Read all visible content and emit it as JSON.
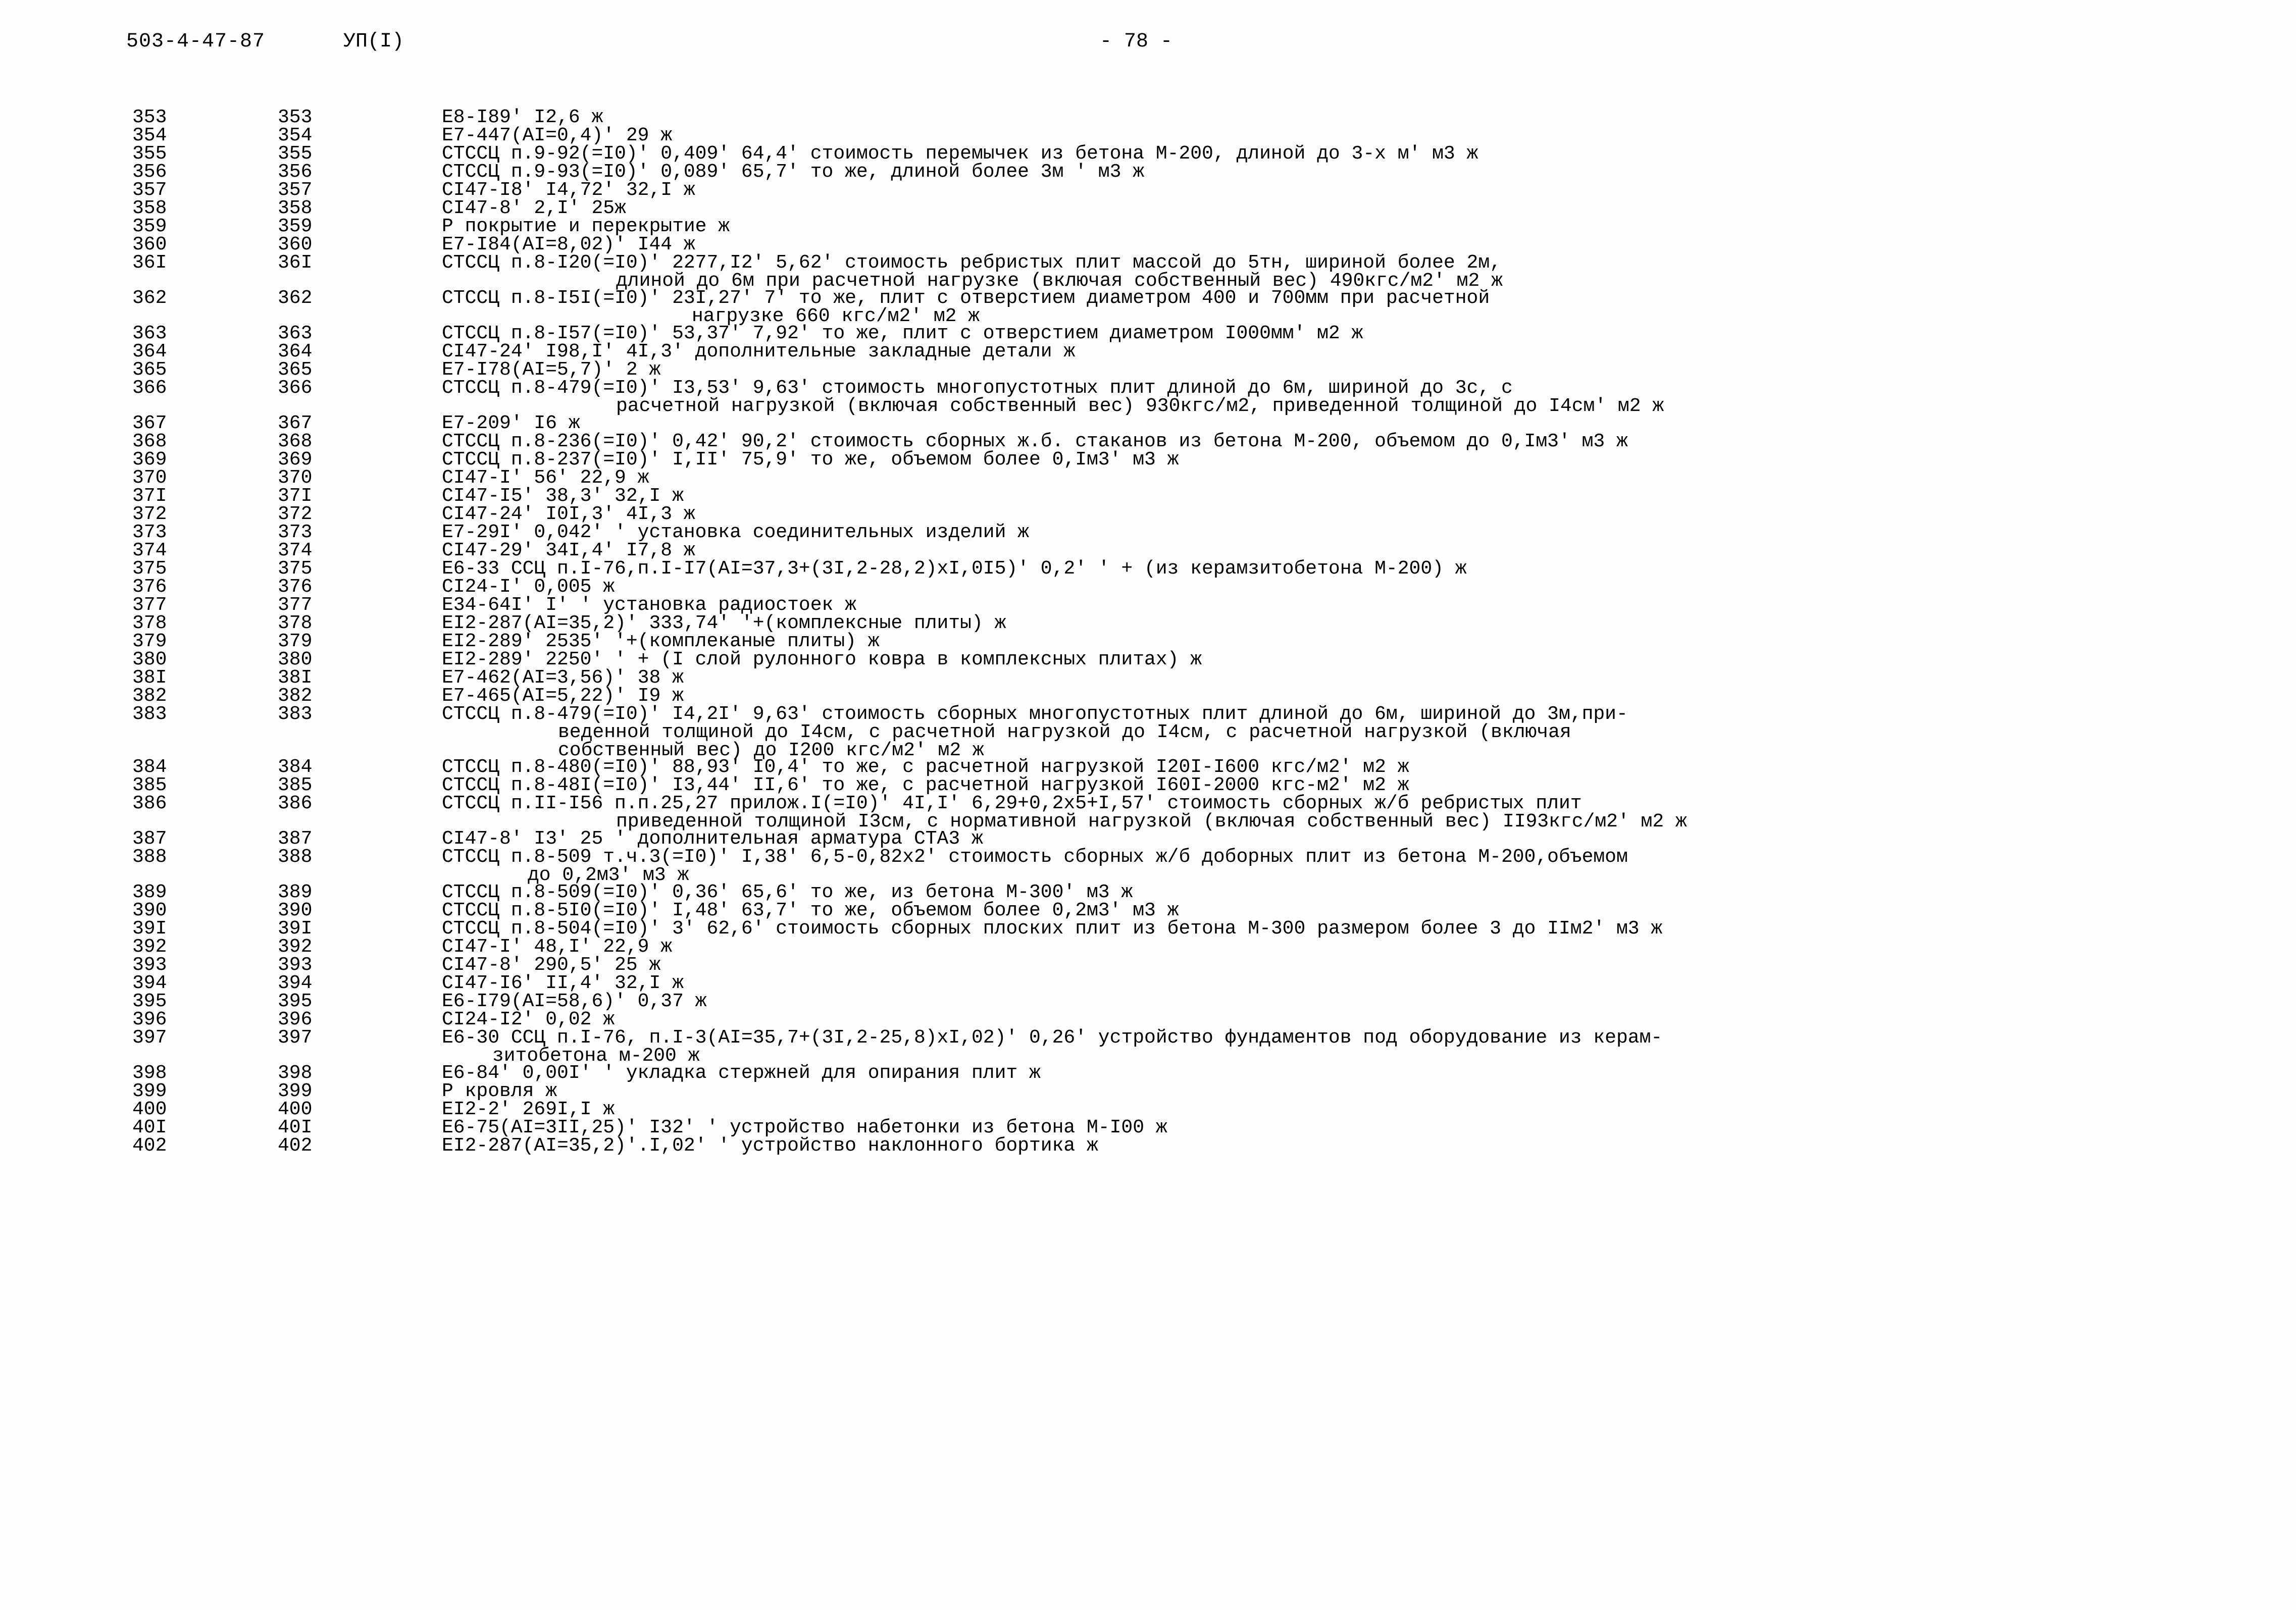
{
  "header": {
    "code": "503-4-47-87",
    "mark": "УП(I)",
    "page": "- 78 -"
  },
  "columns": {
    "col1_header": "",
    "col2_header": "",
    "col3_header": ""
  },
  "rows": [
    {
      "n1": "353",
      "n2": "353",
      "lines": [
        "Е8-I89' I2,6 ж"
      ]
    },
    {
      "n1": "354",
      "n2": "354",
      "lines": [
        "Е7-447(АI=0,4)' 29 ж"
      ]
    },
    {
      "n1": "355",
      "n2": "355",
      "lines": [
        "СТССЦ п.9-92(=I0)' 0,409' 64,4' стоимость перемычек из бетона М-200, длиной до 3-х м' м3 ж"
      ]
    },
    {
      "n1": "356",
      "n2": "356",
      "lines": [
        "СТССЦ п.9-93(=I0)' 0,089' 65,7' то же, длиной более 3м ' м3 ж"
      ]
    },
    {
      "n1": "357",
      "n2": "357",
      "lines": [
        "СI47-I8' I4,72' 32,I ж"
      ]
    },
    {
      "n1": "358",
      "n2": "358",
      "lines": [
        "СI47-8' 2,I' 25ж"
      ]
    },
    {
      "n1": "359",
      "n2": "359",
      "lines": [
        "Р покрытие и перекрытие ж"
      ]
    },
    {
      "n1": "360",
      "n2": "360",
      "lines": [
        "Е7-I84(АI=8,02)' I44 ж"
      ]
    },
    {
      "n1": "36I",
      "n2": "36I",
      "lines": [
        "СТССЦ п.8-I20(=I0)' 2277,I2' 5,62' стоимость ребристых плит массой до 5тн, шириной более 2м,",
        "длиной до 6м при расчетной нагрузке (включая собственный вес) 490кгс/м2' м2 ж"
      ],
      "indent": [
        0,
        1
      ]
    },
    {
      "n1": "362",
      "n2": "362",
      "lines": [
        "СТССЦ п.8-I5I(=I0)' 23I,27' 7' то же, плит с отверстием диаметром 400 и 700мм при расчетной",
        "нагрузке 660 кгс/м2' м2 ж"
      ],
      "indent": [
        0,
        2
      ]
    },
    {
      "n1": "363",
      "n2": "363",
      "lines": [
        "СТССЦ п.8-I57(=I0)' 53,37' 7,92' то же, плит с отверстием диаметром I000мм' м2 ж"
      ]
    },
    {
      "n1": "364",
      "n2": "364",
      "lines": [
        "СI47-24' I98,I' 4I,3' дополнительные закладные детали ж"
      ]
    },
    {
      "n1": "365",
      "n2": "365",
      "lines": [
        "Е7-I78(АI=5,7)' 2 ж"
      ]
    },
    {
      "n1": "366",
      "n2": "366",
      "lines": [
        "СТССЦ п.8-479(=I0)' I3,53' 9,63' стоимость многопустотных плит длиной до 6м, шириной до 3с, с",
        "расчетной нагрузкой (включая собственный вес) 930кгс/м2, приведенной толщиной до I4см' м2 ж"
      ],
      "indent": [
        0,
        1
      ]
    },
    {
      "n1": "367",
      "n2": "367",
      "lines": [
        "Е7-209' I6 ж"
      ]
    },
    {
      "n1": "368",
      "n2": "368",
      "lines": [
        "СТССЦ п.8-236(=I0)' 0,42' 90,2' стоимость сборных ж.б. стаканов из бетона М-200, объемом до 0,Iм3' м3 ж"
      ]
    },
    {
      "n1": "369",
      "n2": "369",
      "lines": [
        "СТССЦ п.8-237(=I0)' I,II' 75,9' то же, объемом более 0,Iм3' м3 ж"
      ]
    },
    {
      "n1": "370",
      "n2": "370",
      "lines": [
        "СI47-I' 56' 22,9 ж"
      ]
    },
    {
      "n1": "37I",
      "n2": "37I",
      "lines": [
        "СI47-I5' 38,3' 32,I ж"
      ]
    },
    {
      "n1": "372",
      "n2": "372",
      "lines": [
        "СI47-24' I0I,3' 4I,3 ж"
      ]
    },
    {
      "n1": "373",
      "n2": "373",
      "lines": [
        "Е7-29I' 0,042' ' установка соединительных изделий ж"
      ]
    },
    {
      "n1": "374",
      "n2": "374",
      "lines": [
        "СI47-29' 34I,4' I7,8 ж"
      ]
    },
    {
      "n1": "375",
      "n2": "375",
      "lines": [
        "Е6-33 ССЦ п.I-76,п.I-I7(АI=37,3+(3I,2-28,2)хI,0I5)' 0,2' ' + (из керамзитобетона М-200) ж"
      ]
    },
    {
      "n1": "376",
      "n2": "376",
      "lines": [
        "СI24-I' 0,005 ж"
      ]
    },
    {
      "n1": "377",
      "n2": "377",
      "lines": [
        "Е34-64I' I' ' установка радиостоек ж"
      ]
    },
    {
      "n1": "378",
      "n2": "378",
      "lines": [
        "ЕI2-287(АI=35,2)' 333,74' '+(комплексные плиты) ж"
      ]
    },
    {
      "n1": "379",
      "n2": "379",
      "lines": [
        "ЕI2-289' 2535' '+(комплеканые плиты) ж"
      ]
    },
    {
      "n1": "380",
      "n2": "380",
      "lines": [
        "ЕI2-289' 2250' ' + (I слой рулонного ковра в комплексных плитах) ж"
      ]
    },
    {
      "n1": "38I",
      "n2": "38I",
      "lines": [
        "Е7-462(АI=3,56)' 38 ж"
      ]
    },
    {
      "n1": "382",
      "n2": "382",
      "lines": [
        "Е7-465(АI=5,22)' I9 ж"
      ]
    },
    {
      "n1": "383",
      "n2": "383",
      "lines": [
        "СТССЦ п.8-479(=I0)' I4,2I' 9,63' стоимость сборных многопустотных плит длиной до 6м, шириной до 3м,при-",
        "веденной толщиной до I4см, с расчетной нагрузкой до I4см, с расчетной нагрузкой (включая",
        "собственный вес) до I200 кгс/м2' м2 ж"
      ],
      "indent": [
        0,
        3,
        3
      ]
    },
    {
      "n1": "384",
      "n2": "384",
      "lines": [
        "СТССЦ п.8-480(=I0)' 88,93' I0,4' то же, с расчетной нагрузкой I20I-I600 кгс/м2' м2 ж"
      ]
    },
    {
      "n1": "385",
      "n2": "385",
      "lines": [
        "СТССЦ п.8-48I(=I0)' I3,44' II,6' то же, с расчетной нагрузкой I60I-2000 кгс-м2' м2 ж"
      ]
    },
    {
      "n1": "386",
      "n2": "386",
      "lines": [
        "СТССЦ п.II-I56 п.п.25,27 прилож.I(=I0)' 4I,I' 6,29+0,2х5+I,57' стоимость сборных ж/б ребристых плит",
        "приведенной толщиной I3см, с нормативной нагрузкой (включая собственный вес) II93кгс/м2' м2 ж"
      ],
      "indent": [
        0,
        1
      ]
    },
    {
      "n1": "387",
      "n2": "387",
      "lines": [
        "СI47-8' I3' 25 ' дополнительная арматура СТА3 ж"
      ]
    },
    {
      "n1": "388",
      "n2": "388",
      "lines": [
        "СТССЦ п.8-509 т.ч.3(=I0)' I,38' 6,5-0,82х2' стоимость сборных ж/б доборных плит из бетона М-200,объемом",
        "до 0,2м3' м3 ж"
      ],
      "indent": [
        0,
        4
      ]
    },
    {
      "n1": "389",
      "n2": "389",
      "lines": [
        "СТССЦ п.8-509(=I0)' 0,36' 65,6' то же, из бетона М-300' м3 ж"
      ]
    },
    {
      "n1": "390",
      "n2": "390",
      "lines": [
        "СТССЦ п.8-5I0(=I0)' I,48' 63,7' то же, объемом более 0,2м3' м3 ж"
      ]
    },
    {
      "n1": "39I",
      "n2": "39I",
      "lines": [
        "СТССЦ п.8-504(=I0)' 3' 62,6' стоимость сборных плоских плит из бетона М-300 размером более 3 до IIм2' м3 ж"
      ]
    },
    {
      "n1": "392",
      "n2": "392",
      "lines": [
        "СI47-I' 48,I' 22,9 ж"
      ]
    },
    {
      "n1": "393",
      "n2": "393",
      "lines": [
        "СI47-8' 290,5' 25 ж"
      ]
    },
    {
      "n1": "394",
      "n2": "394",
      "lines": [
        "СI47-I6' II,4' 32,I ж"
      ]
    },
    {
      "n1": "395",
      "n2": "395",
      "lines": [
        "Е6-I79(АI=58,6)' 0,37 ж"
      ]
    },
    {
      "n1": "396",
      "n2": "396",
      "lines": [
        "СI24-I2' 0,02 ж"
      ]
    },
    {
      "n1": "397",
      "n2": "397",
      "lines": [
        "Е6-30 ССЦ п.I-76, п.I-3(АI=35,7+(3I,2-25,8)хI,02)' 0,26' устройство фундаментов под оборудование из керам-",
        "зитобетона м-200 ж"
      ],
      "indent": [
        0,
        5
      ]
    },
    {
      "n1": "398",
      "n2": "398",
      "lines": [
        "Е6-84' 0,00I' ' укладка стержней для опирания плит ж"
      ]
    },
    {
      "n1": "399",
      "n2": "399",
      "lines": [
        "Р кровля ж"
      ]
    },
    {
      "n1": "400",
      "n2": "400",
      "lines": [
        "ЕI2-2' 269I,I ж"
      ]
    },
    {
      "n1": "40I",
      "n2": "40I",
      "lines": [
        "Е6-75(АI=3II,25)' I32' ' устройство набетонки из бетона М-I00 ж"
      ]
    },
    {
      "n1": "402",
      "n2": "402",
      "lines": [
        "ЕI2-287(АI=35,2)'.I,02' ' устройство наклонного бортика ж"
      ]
    }
  ]
}
